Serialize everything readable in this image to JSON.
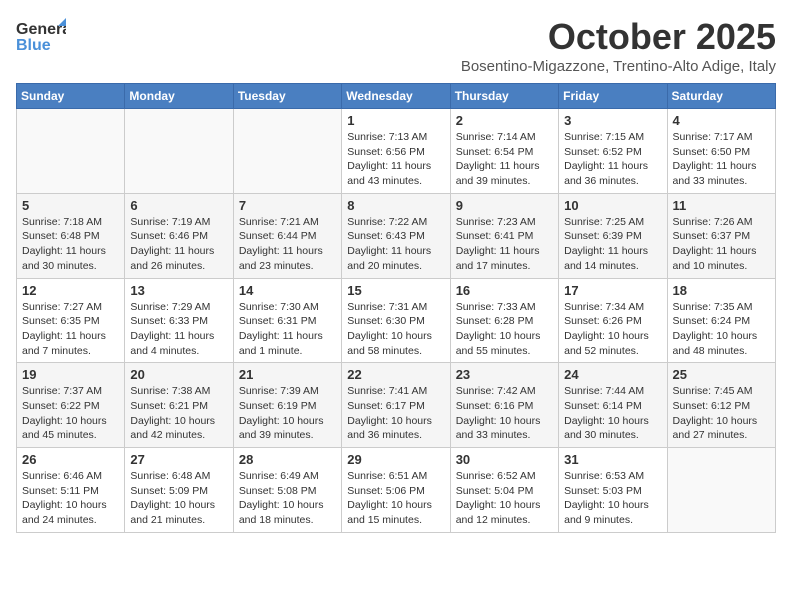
{
  "header": {
    "logo_general": "General",
    "logo_blue": "Blue",
    "month_title": "October 2025",
    "location": "Bosentino-Migazzone, Trentino-Alto Adige, Italy"
  },
  "days_of_week": [
    "Sunday",
    "Monday",
    "Tuesday",
    "Wednesday",
    "Thursday",
    "Friday",
    "Saturday"
  ],
  "weeks": [
    [
      {
        "day": "",
        "info": ""
      },
      {
        "day": "",
        "info": ""
      },
      {
        "day": "",
        "info": ""
      },
      {
        "day": "1",
        "info": "Sunrise: 7:13 AM\nSunset: 6:56 PM\nDaylight: 11 hours and 43 minutes."
      },
      {
        "day": "2",
        "info": "Sunrise: 7:14 AM\nSunset: 6:54 PM\nDaylight: 11 hours and 39 minutes."
      },
      {
        "day": "3",
        "info": "Sunrise: 7:15 AM\nSunset: 6:52 PM\nDaylight: 11 hours and 36 minutes."
      },
      {
        "day": "4",
        "info": "Sunrise: 7:17 AM\nSunset: 6:50 PM\nDaylight: 11 hours and 33 minutes."
      }
    ],
    [
      {
        "day": "5",
        "info": "Sunrise: 7:18 AM\nSunset: 6:48 PM\nDaylight: 11 hours and 30 minutes."
      },
      {
        "day": "6",
        "info": "Sunrise: 7:19 AM\nSunset: 6:46 PM\nDaylight: 11 hours and 26 minutes."
      },
      {
        "day": "7",
        "info": "Sunrise: 7:21 AM\nSunset: 6:44 PM\nDaylight: 11 hours and 23 minutes."
      },
      {
        "day": "8",
        "info": "Sunrise: 7:22 AM\nSunset: 6:43 PM\nDaylight: 11 hours and 20 minutes."
      },
      {
        "day": "9",
        "info": "Sunrise: 7:23 AM\nSunset: 6:41 PM\nDaylight: 11 hours and 17 minutes."
      },
      {
        "day": "10",
        "info": "Sunrise: 7:25 AM\nSunset: 6:39 PM\nDaylight: 11 hours and 14 minutes."
      },
      {
        "day": "11",
        "info": "Sunrise: 7:26 AM\nSunset: 6:37 PM\nDaylight: 11 hours and 10 minutes."
      }
    ],
    [
      {
        "day": "12",
        "info": "Sunrise: 7:27 AM\nSunset: 6:35 PM\nDaylight: 11 hours and 7 minutes."
      },
      {
        "day": "13",
        "info": "Sunrise: 7:29 AM\nSunset: 6:33 PM\nDaylight: 11 hours and 4 minutes."
      },
      {
        "day": "14",
        "info": "Sunrise: 7:30 AM\nSunset: 6:31 PM\nDaylight: 11 hours and 1 minute."
      },
      {
        "day": "15",
        "info": "Sunrise: 7:31 AM\nSunset: 6:30 PM\nDaylight: 10 hours and 58 minutes."
      },
      {
        "day": "16",
        "info": "Sunrise: 7:33 AM\nSunset: 6:28 PM\nDaylight: 10 hours and 55 minutes."
      },
      {
        "day": "17",
        "info": "Sunrise: 7:34 AM\nSunset: 6:26 PM\nDaylight: 10 hours and 52 minutes."
      },
      {
        "day": "18",
        "info": "Sunrise: 7:35 AM\nSunset: 6:24 PM\nDaylight: 10 hours and 48 minutes."
      }
    ],
    [
      {
        "day": "19",
        "info": "Sunrise: 7:37 AM\nSunset: 6:22 PM\nDaylight: 10 hours and 45 minutes."
      },
      {
        "day": "20",
        "info": "Sunrise: 7:38 AM\nSunset: 6:21 PM\nDaylight: 10 hours and 42 minutes."
      },
      {
        "day": "21",
        "info": "Sunrise: 7:39 AM\nSunset: 6:19 PM\nDaylight: 10 hours and 39 minutes."
      },
      {
        "day": "22",
        "info": "Sunrise: 7:41 AM\nSunset: 6:17 PM\nDaylight: 10 hours and 36 minutes."
      },
      {
        "day": "23",
        "info": "Sunrise: 7:42 AM\nSunset: 6:16 PM\nDaylight: 10 hours and 33 minutes."
      },
      {
        "day": "24",
        "info": "Sunrise: 7:44 AM\nSunset: 6:14 PM\nDaylight: 10 hours and 30 minutes."
      },
      {
        "day": "25",
        "info": "Sunrise: 7:45 AM\nSunset: 6:12 PM\nDaylight: 10 hours and 27 minutes."
      }
    ],
    [
      {
        "day": "26",
        "info": "Sunrise: 6:46 AM\nSunset: 5:11 PM\nDaylight: 10 hours and 24 minutes."
      },
      {
        "day": "27",
        "info": "Sunrise: 6:48 AM\nSunset: 5:09 PM\nDaylight: 10 hours and 21 minutes."
      },
      {
        "day": "28",
        "info": "Sunrise: 6:49 AM\nSunset: 5:08 PM\nDaylight: 10 hours and 18 minutes."
      },
      {
        "day": "29",
        "info": "Sunrise: 6:51 AM\nSunset: 5:06 PM\nDaylight: 10 hours and 15 minutes."
      },
      {
        "day": "30",
        "info": "Sunrise: 6:52 AM\nSunset: 5:04 PM\nDaylight: 10 hours and 12 minutes."
      },
      {
        "day": "31",
        "info": "Sunrise: 6:53 AM\nSunset: 5:03 PM\nDaylight: 10 hours and 9 minutes."
      },
      {
        "day": "",
        "info": ""
      }
    ]
  ]
}
